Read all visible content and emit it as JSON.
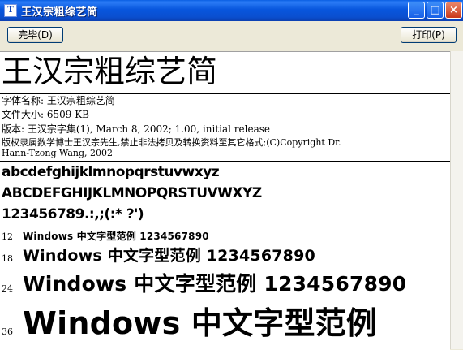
{
  "window": {
    "title": "王汉宗粗综艺简",
    "icon_glyph": "T",
    "minimize_glyph": "_",
    "maximize_glyph": "□",
    "close_glyph": "×"
  },
  "toolbar": {
    "done_label": "完毕(D)",
    "print_label": "打印(P)"
  },
  "preview": {
    "font_name_large": "王汉宗粗综艺简",
    "info": {
      "name_line": "字体名称: 王汉宗粗综艺简",
      "size_line": "文件大小: 6509 KB",
      "version_line": "版本: 王汉宗字集(1), March 8, 2002; 1.00, initial release",
      "copyright_line1": "版权隶属数学博士王汉宗先生,禁止非法拷贝及转换资料至其它格式;(C)Copyright Dr.",
      "copyright_line2": "Hann-Tzong Wang, 2002"
    },
    "samples": {
      "lowercase": "abcdefghijklmnopqrstuvwxyz",
      "uppercase": "ABCDEFGHIJKLMNOPQRSTUVWXYZ",
      "digits": "123456789.:,;(:* ?')"
    },
    "size_rows": [
      {
        "size": "12",
        "text": "Windows 中文字型范例 1234567890"
      },
      {
        "size": "18",
        "text": "Windows 中文字型范例 1234567890"
      },
      {
        "size": "24",
        "text": "Windows 中文字型范例 1234567890"
      },
      {
        "size": "36",
        "text": "Windows 中文字型范例"
      }
    ]
  }
}
